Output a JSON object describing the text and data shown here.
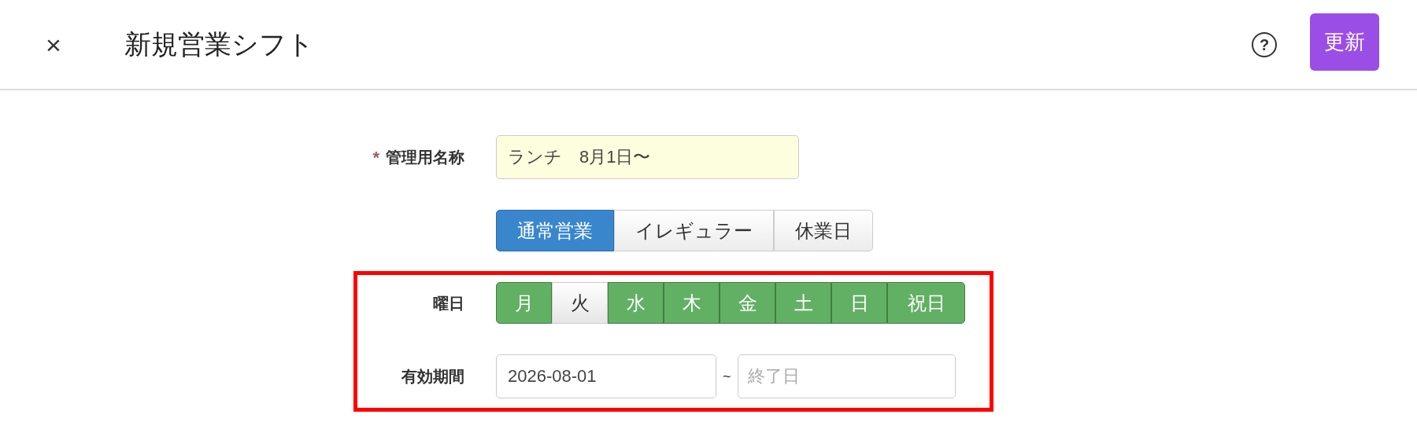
{
  "header": {
    "close": "×",
    "title": "新規営業シフト",
    "help": "?",
    "update_button": "更新"
  },
  "name_field": {
    "label": "管理用名称",
    "required_mark": "*",
    "value": "ランチ　8月1日〜"
  },
  "shift_types": [
    {
      "label": "通常営業",
      "selected": true
    },
    {
      "label": "イレギュラー",
      "selected": false
    },
    {
      "label": "休業日",
      "selected": false
    }
  ],
  "highlighted_section": {
    "highlighted": true,
    "weekdays": {
      "label": "曜日",
      "days": [
        {
          "label": "月",
          "selected": true
        },
        {
          "label": "火",
          "selected": false
        },
        {
          "label": "水",
          "selected": true
        },
        {
          "label": "木",
          "selected": true
        },
        {
          "label": "金",
          "selected": true
        },
        {
          "label": "土",
          "selected": true
        },
        {
          "label": "日",
          "selected": true
        },
        {
          "label": "祝日",
          "selected": true
        }
      ]
    },
    "period": {
      "label": "有効期間",
      "start_value": "2026-08-01",
      "separator": "~",
      "end_placeholder": "終了日"
    }
  }
}
